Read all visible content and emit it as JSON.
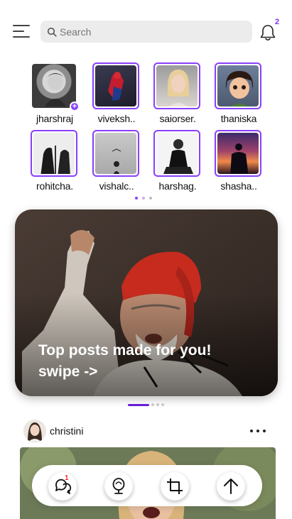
{
  "search": {
    "placeholder": "Search"
  },
  "notifications": {
    "count": "2",
    "accent": "#7b2ff7"
  },
  "stories": [
    {
      "name": "jharshraj",
      "ring": false,
      "own": true
    },
    {
      "name": "viveksh..",
      "ring": true
    },
    {
      "name": "saiorser.",
      "ring": true
    },
    {
      "name": "thaniska",
      "ring": true
    },
    {
      "name": "rohitcha.",
      "ring": true
    },
    {
      "name": "vishalc..",
      "ring": true
    },
    {
      "name": "harshag.",
      "ring": true
    },
    {
      "name": "shasha..",
      "ring": true
    }
  ],
  "hero": {
    "caption": "Top posts made for you! swipe ->"
  },
  "post": {
    "username": "christini"
  },
  "bottom_nav": {
    "items": [
      {
        "icon": "chat-bubbles-icon",
        "badge": "1"
      },
      {
        "icon": "microphone-icon"
      },
      {
        "icon": "crop-icon"
      },
      {
        "icon": "arrow-up-icon"
      }
    ]
  },
  "colors": {
    "accent": "#8a3ffc",
    "badge_red": "#e5302c"
  }
}
